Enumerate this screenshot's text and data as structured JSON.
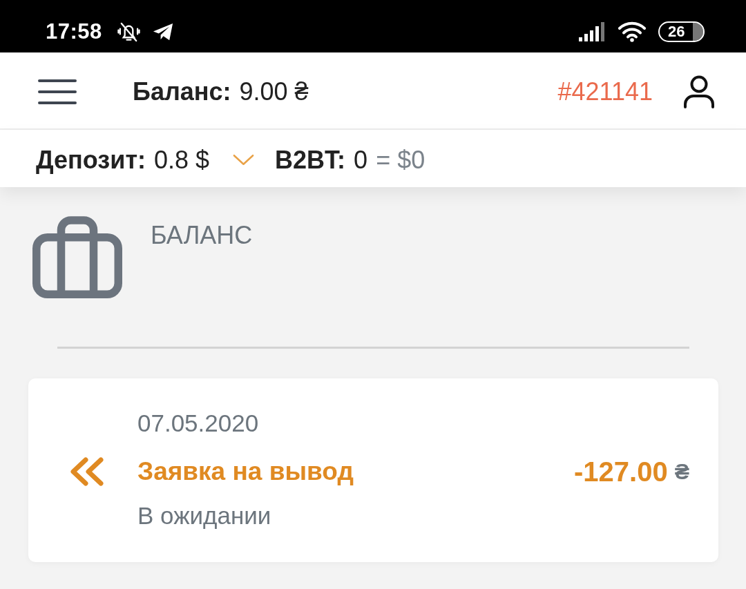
{
  "status_bar": {
    "time": "17:58",
    "battery": "26"
  },
  "header": {
    "balance_label": "Баланс:",
    "balance_amount": "9.00 ₴",
    "account_id": "#421141"
  },
  "sub_bar": {
    "deposit_label": "Депозит:",
    "deposit_value": "0.8 $",
    "expanded": false,
    "token_label": "B2BT:",
    "token_value": "0",
    "token_usd": "= $0"
  },
  "balance_section": {
    "title": "БАЛАНС"
  },
  "transactions": [
    {
      "kind": "withdrawal",
      "date": "07.05.2020",
      "title": "Заявка на вывод",
      "amount": "-127.00",
      "currency": "₴",
      "status": "В ожидании"
    }
  ]
}
